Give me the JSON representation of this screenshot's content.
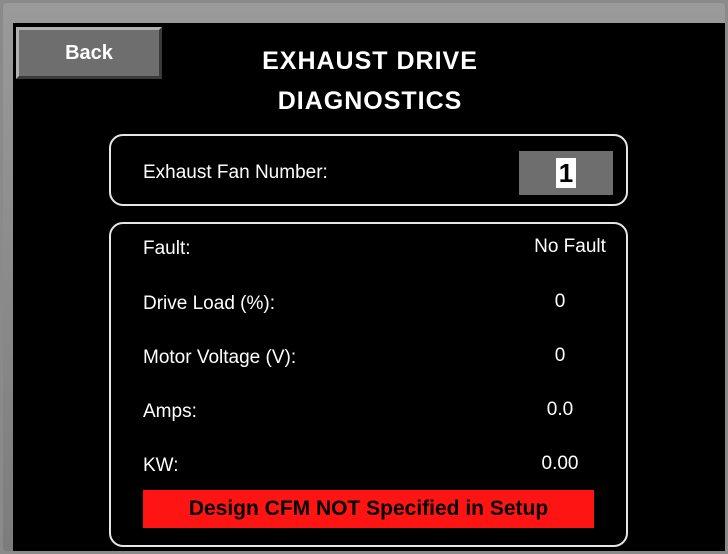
{
  "header": {
    "back_label": "Back",
    "title_line1": "EXHAUST DRIVE",
    "title_line2": "DIAGNOSTICS"
  },
  "fan_selector": {
    "label": "Exhaust Fan Number:",
    "value": "1"
  },
  "diagnostics": [
    {
      "label": "Fault:",
      "value": "No Fault"
    },
    {
      "label": "Drive Load (%):",
      "value": "0"
    },
    {
      "label": "Motor Voltage (V):",
      "value": "0"
    },
    {
      "label": "Amps:",
      "value": "0.0"
    },
    {
      "label": "KW:",
      "value": "0.00"
    }
  ],
  "alarm": {
    "text": "Design CFM NOT Specified in Setup",
    "color": "#ff1414"
  },
  "colors": {
    "background": "#000000",
    "button": "#6e6e6e",
    "text": "#ffffff"
  }
}
